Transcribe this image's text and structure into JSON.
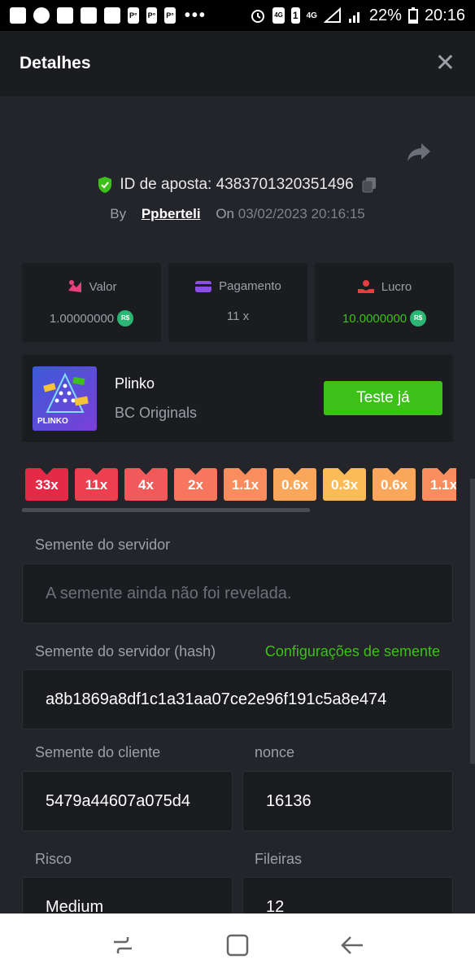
{
  "status_bar": {
    "battery": "22%",
    "time": "20:16",
    "network": "4G",
    "sim_number": "1"
  },
  "header": {
    "title": "Detalhes",
    "close": "✕"
  },
  "bet": {
    "id_label": "ID de aposta: 4383701320351496",
    "by": "By",
    "user": "Ppberteli",
    "on": "On",
    "date": "03/02/2023 20:16:15"
  },
  "stats": [
    {
      "label": "Valor",
      "value": "1.00000000",
      "currency": "R$"
    },
    {
      "label": "Pagamento",
      "value": "11 x"
    },
    {
      "label": "Lucro",
      "value": "10.0000000",
      "currency": "R$"
    }
  ],
  "game": {
    "name": "Plinko",
    "provider": "BC Originals",
    "button": "Teste já",
    "thumb_label": "PLINKO"
  },
  "multipliers": [
    {
      "label": "33x",
      "color": "#e52a48"
    },
    {
      "label": "11x",
      "color": "#ec3f4f"
    },
    {
      "label": "4x",
      "color": "#f2595a"
    },
    {
      "label": "2x",
      "color": "#f7765d"
    },
    {
      "label": "1.1x",
      "color": "#f98d5d"
    },
    {
      "label": "0.6x",
      "color": "#fba75b"
    },
    {
      "label": "0.3x",
      "color": "#fdbb57"
    },
    {
      "label": "0.6x",
      "color": "#fba75b"
    },
    {
      "label": "1.1x",
      "color": "#f98d5d"
    }
  ],
  "seeds": {
    "server_seed_label": "Semente do servidor",
    "server_seed_placeholder": "A semente ainda não foi revelada.",
    "server_hash_label": "Semente do servidor (hash)",
    "seed_settings_link": "Configurações de semente",
    "server_hash_value": "a8b1869a8df1c1a31aa07ce2e96f191c5a8e474",
    "client_seed_label": "Semente do cliente",
    "client_seed_value": "5479a44607a075d4",
    "nonce_label": "nonce",
    "nonce_value": "16136",
    "risk_label": "Risco",
    "risk_value": "Medium",
    "rows_label": "Fileiras",
    "rows_value": "12"
  }
}
